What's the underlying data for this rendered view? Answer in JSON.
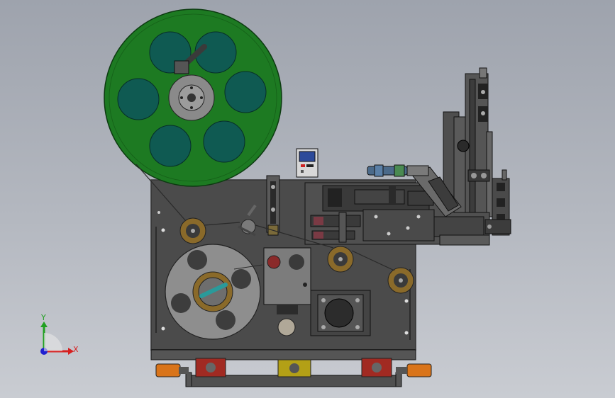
{
  "colors": {
    "background_top": "#9ea3ad",
    "background_bottom": "#c9ccd2",
    "reel": "#1d7a22",
    "reel_holes": "#0f5a52",
    "frame": "#4a4a4a",
    "roller_ring": "#8a6a2a",
    "orange_parts": "#d9741a",
    "red_parts": "#a12a22",
    "yellow_parts": "#b3a016",
    "axis_x": "#d62020",
    "axis_y": "#20a020",
    "axis_z": "#2020d0"
  },
  "axes": {
    "x_label": "X",
    "y_label": "Y"
  },
  "icons": {
    "triad": "coordinate-triad-icon"
  }
}
